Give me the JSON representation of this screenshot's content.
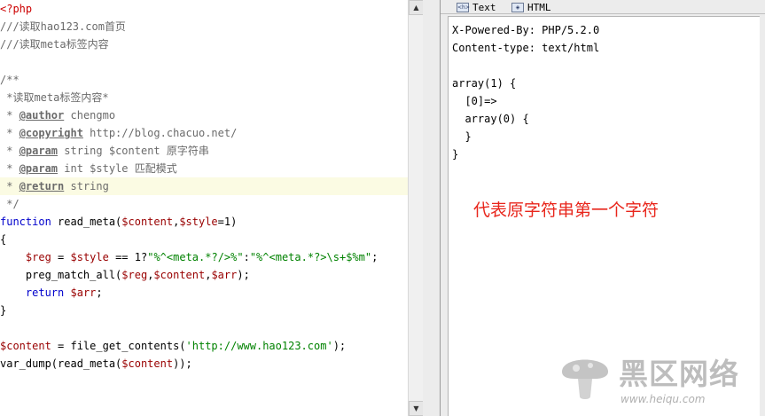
{
  "editor": {
    "lines": [
      [
        [
          "php",
          "<?php"
        ]
      ],
      [
        [
          "cmt",
          "///读取hao123.com首页"
        ]
      ],
      [
        [
          "cmt",
          "///读取meta标签内容"
        ]
      ],
      [],
      [
        [
          "cmt",
          "/**"
        ]
      ],
      [
        [
          "cmt",
          " *读取meta标签内容*"
        ]
      ],
      [
        [
          "cmt",
          " * "
        ],
        [
          "doc",
          "@author"
        ],
        [
          "cmt",
          " chengmo"
        ]
      ],
      [
        [
          "cmt",
          " * "
        ],
        [
          "doc",
          "@copyright"
        ],
        [
          "cmt",
          " http://blog.chacuo.net/"
        ]
      ],
      [
        [
          "cmt",
          " * "
        ],
        [
          "doc",
          "@param"
        ],
        [
          "cmt",
          " string $content 原字符串"
        ]
      ],
      [
        [
          "cmt",
          " * "
        ],
        [
          "doc",
          "@param"
        ],
        [
          "cmt",
          " int $style 匹配模式"
        ]
      ],
      [
        [
          "cmt",
          " * "
        ],
        [
          "doc",
          "@return"
        ],
        [
          "cmt",
          " string"
        ]
      ],
      [
        [
          "cmt",
          " */"
        ]
      ],
      [
        [
          "kw",
          "function"
        ],
        [
          "plain",
          " read_meta("
        ],
        [
          "var",
          "$content"
        ],
        [
          "plain",
          ","
        ],
        [
          "var",
          "$style"
        ],
        [
          "plain",
          "=1)"
        ]
      ],
      [
        [
          "plain",
          "{"
        ]
      ],
      [
        [
          "plain",
          "    "
        ],
        [
          "var",
          "$reg"
        ],
        [
          "plain",
          " = "
        ],
        [
          "var",
          "$style"
        ],
        [
          "plain",
          " == 1?"
        ],
        [
          "str",
          "\"%^<meta.*?/>%\""
        ],
        [
          "plain",
          ":"
        ],
        [
          "str",
          "\"%^<meta.*?>\\s+$%m\""
        ],
        [
          "plain",
          ";"
        ]
      ],
      [
        [
          "plain",
          "    preg_match_all("
        ],
        [
          "var",
          "$reg"
        ],
        [
          "plain",
          ","
        ],
        [
          "var",
          "$content"
        ],
        [
          "plain",
          ","
        ],
        [
          "var",
          "$arr"
        ],
        [
          "plain",
          ");"
        ]
      ],
      [
        [
          "plain",
          "    "
        ],
        [
          "kw",
          "return"
        ],
        [
          "plain",
          " "
        ],
        [
          "var",
          "$arr"
        ],
        [
          "plain",
          ";"
        ]
      ],
      [
        [
          "plain",
          "}"
        ]
      ],
      [],
      [
        [
          "var",
          "$content"
        ],
        [
          "plain",
          " = file_get_contents("
        ],
        [
          "str",
          "'http://www.hao123.com'"
        ],
        [
          "plain",
          ");"
        ]
      ],
      [
        [
          "plain",
          "var_dump(read_meta("
        ],
        [
          "var",
          "$content"
        ],
        [
          "plain",
          "));"
        ]
      ]
    ],
    "highlighted_line": 10
  },
  "output": {
    "tabs": [
      {
        "label": "Text",
        "icon": "text-view-icon"
      },
      {
        "label": "HTML",
        "icon": "html-view-icon"
      }
    ],
    "lines": [
      "X-Powered-By: PHP/5.2.0",
      "Content-type: text/html",
      "",
      "array(1) {",
      "  [0]=>",
      "  array(0) {",
      "  }",
      "}"
    ],
    "annotation": "代表原字符串第一个字符",
    "annotation_color": "#e8261c"
  },
  "watermark": {
    "title": "黑区网络",
    "url": "www.heiqu.com",
    "icon": "mushroom-logo-icon"
  },
  "colors": {
    "keyword": "#0000cc",
    "variable": "#990000",
    "string": "#008200",
    "comment": "#6b6b6b",
    "php_tag": "#cc0000",
    "highlight_line": "#fbfbe3"
  }
}
